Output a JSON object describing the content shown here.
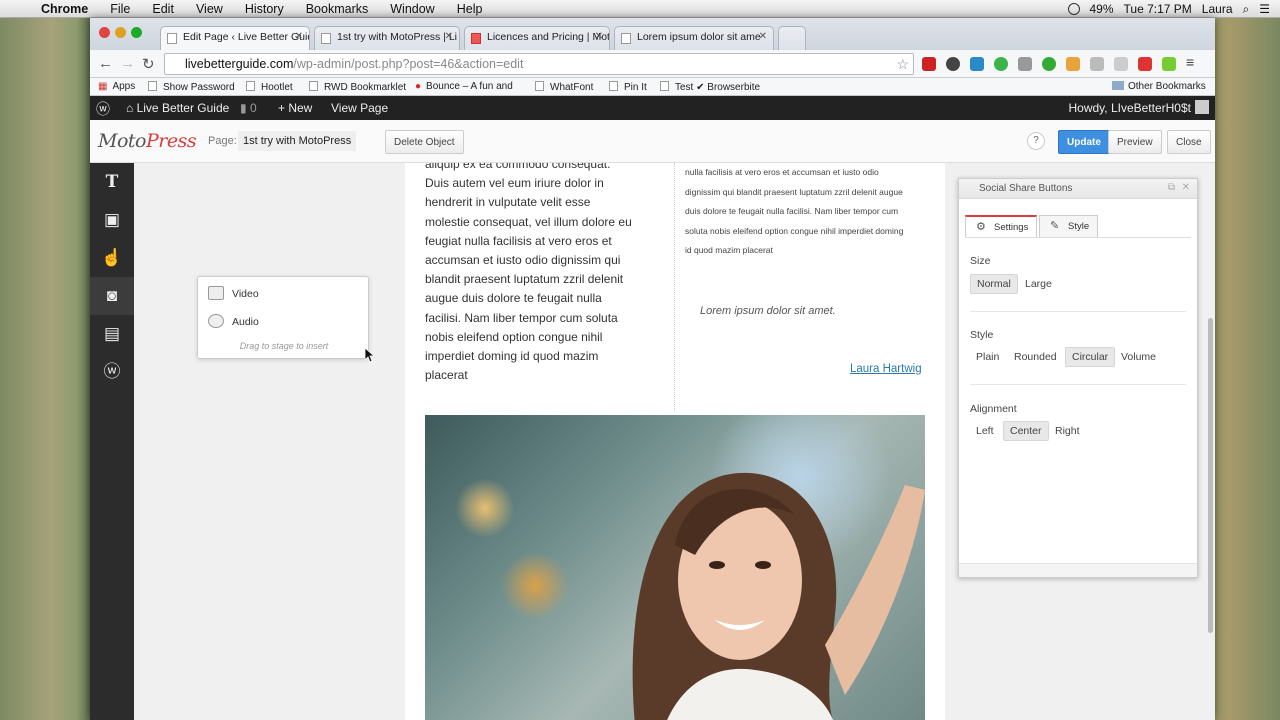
{
  "menubar": {
    "apple": "",
    "app": "Chrome",
    "items": [
      "File",
      "Edit",
      "View",
      "History",
      "Bookmarks",
      "Window",
      "Help"
    ],
    "battery": "49%",
    "time": "Tue 7:17 PM",
    "user": "Laura"
  },
  "tabs": [
    {
      "title": "Edit Page ‹ Live Better Guid"
    },
    {
      "title": "1st try with MotoPress | Li"
    },
    {
      "title": "Licences and Pricing | Mot"
    },
    {
      "title": "Lorem ipsum dolor sit ame"
    }
  ],
  "omnibox": {
    "host": "livebetterguide.com",
    "path": "/wp-admin/post.php?post=46&action=edit"
  },
  "bookmarks": {
    "items": [
      "Apps",
      "Show Password",
      "Hootlet",
      "RWD Bookmarklet",
      "Bounce – A fun and",
      "WhatFont",
      "Pin It",
      "Test ✔ Browserbite"
    ],
    "other": "Other Bookmarks"
  },
  "adminbar": {
    "site": "Live Better Guide",
    "comments": "0",
    "new": "New",
    "view": "View Page",
    "howdy": "Howdy, LIveBetterH0$t"
  },
  "motopress": {
    "logo_moto": "Moto",
    "logo_press": "Press",
    "page_label": "Page:",
    "page_name": "1st try with MotoPress",
    "delete": "Delete Object",
    "help": "?",
    "update": "Update",
    "preview": "Preview",
    "close": "Close"
  },
  "popover": {
    "video": "Video",
    "audio": "Audio",
    "hint": "Drag to stage to insert"
  },
  "content": {
    "col1": "aliquip ex ea commodo consequat. Duis autem vel eum iriure dolor in hendrerit in vulputate velit esse molestie consequat, vel illum dolore eu feugiat nulla facilisis at vero eros et accumsan et iusto odio dignissim qui blandit praesent luptatum zzril delenit augue duis dolore te feugait nulla facilisi. Nam liber tempor cum soluta nobis eleifend option congue nihil imperdiet doming id quod mazim placerat",
    "col2_lines": [
      "nulla facilisis at vero eros et accumsan et iusto odio",
      "dignissim qui blandit praesent luptatum zzril delenit augue",
      "duis dolore te feugait nulla facilisi. Nam liber tempor cum",
      "soluta nobis eleifend option congue nihil imperdiet doming",
      "id quod mazim placerat"
    ],
    "quote": "Lorem ipsum dolor sit amet.",
    "author": "Laura Hartwig"
  },
  "panel": {
    "title": "Social Share Buttons",
    "tab_settings": "Settings",
    "tab_style": "Style",
    "size_label": "Size",
    "size_options": [
      "Normal",
      "Large"
    ],
    "size_selected": "Normal",
    "style_label": "Style",
    "style_options": [
      "Plain",
      "Rounded",
      "Circular",
      "Volume"
    ],
    "style_selected": "Circular",
    "align_label": "Alignment",
    "align_options": [
      "Left",
      "Center",
      "Right"
    ],
    "align_selected": "Center"
  },
  "colors": {
    "accent": "#3d8fe0",
    "brand": "#d83c3c",
    "adminbar": "#222222",
    "leftbar": "#2c2c2c"
  }
}
